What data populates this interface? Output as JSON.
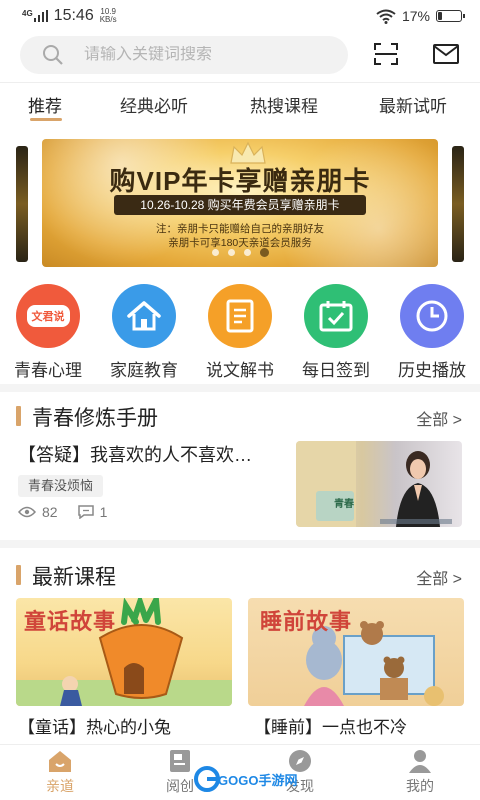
{
  "status_bar": {
    "network": "4G",
    "time": "15:46",
    "speed_value": "10.9",
    "speed_unit": "KB/s",
    "battery": "17%",
    "battery_level": 0.17
  },
  "search": {
    "placeholder": "请输入关键词搜索"
  },
  "tabs": [
    {
      "label": "推荐",
      "active": true
    },
    {
      "label": "经典必听"
    },
    {
      "label": "热搜课程"
    },
    {
      "label": "最新试听"
    }
  ],
  "banner": {
    "title": "购VIP年卡享赠亲朋卡",
    "pill": "10.26-10.28 购买年费会员享赠亲朋卡",
    "note1": "注：亲朋卡只能赠给自己的亲朋好友",
    "note2": "亲朋卡可享180天亲道会员服务",
    "active_dot": 3
  },
  "categories": [
    {
      "label": "青春心理",
      "icon": "wenjunshuo-icon",
      "badge": "文君说",
      "color": "#f05a3c"
    },
    {
      "label": "家庭教育",
      "icon": "house-icon",
      "color": "#3a9be8"
    },
    {
      "label": "说文解书",
      "icon": "document-icon",
      "color": "#f5a028"
    },
    {
      "label": "每日签到",
      "icon": "calendar-check-icon",
      "color": "#2fbf75"
    },
    {
      "label": "历史播放",
      "icon": "clock-icon",
      "color": "#6f7ef0"
    }
  ],
  "section_youth": {
    "title": "青春修炼手册",
    "more": "全部 >",
    "article": {
      "title": "【答疑】我喜欢的人不喜欢…",
      "tag": "青春没烦恼",
      "views": "82",
      "comments": "1",
      "thumb_caption": "青春"
    }
  },
  "section_latest": {
    "title": "最新课程",
    "more": "全部 >",
    "courses": [
      {
        "title": "【童话】热心的小兔",
        "image_text": "童话故事"
      },
      {
        "title": "【睡前】一点也不冷",
        "image_text": "睡前故事"
      }
    ]
  },
  "bottom_nav": [
    {
      "label": "亲道",
      "icon": "home-icon",
      "active": true
    },
    {
      "label": "阅创",
      "icon": "book-icon"
    },
    {
      "label": "发现",
      "icon": "compass-icon"
    },
    {
      "label": "我的",
      "icon": "user-icon"
    }
  ],
  "watermark": {
    "text": "GOGO手游网"
  },
  "colors": {
    "accent": "#d9a46a",
    "banner_gold": "#f6cf6a"
  }
}
